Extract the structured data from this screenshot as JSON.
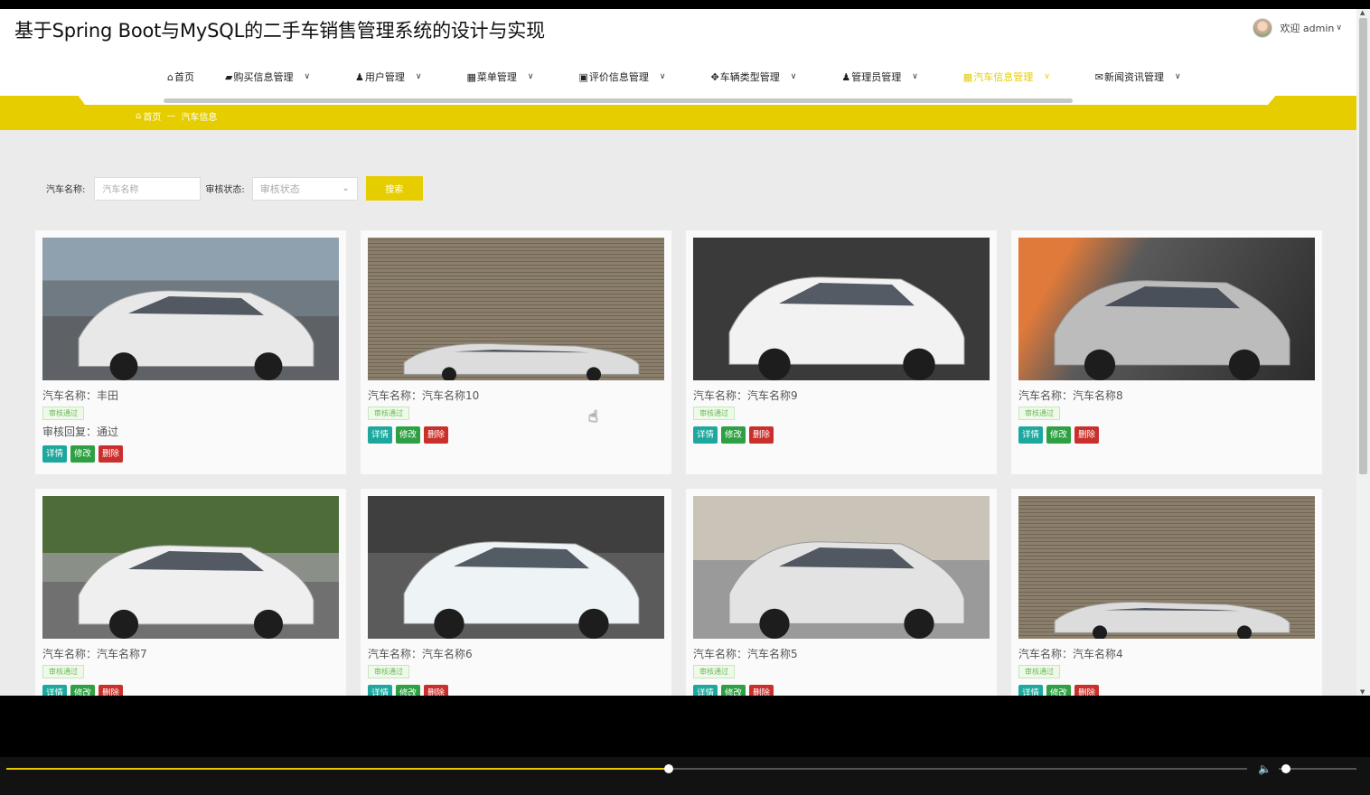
{
  "header": {
    "title": "基于Spring Boot与MySQL的二手车销售管理系统的设计与实现",
    "welcome": "欢迎 admin",
    "user_chevron": "∨"
  },
  "nav": {
    "items": [
      {
        "icon": "⌂",
        "label": "首页",
        "chev": ""
      },
      {
        "icon": "▰",
        "label": "购买信息管理",
        "chev": "∨"
      },
      {
        "icon": "♟",
        "label": "用户管理",
        "chev": "∨"
      },
      {
        "icon": "▦",
        "label": "菜单管理",
        "chev": "∨"
      },
      {
        "icon": "▣",
        "label": "评价信息管理",
        "chev": "∨"
      },
      {
        "icon": "✥",
        "label": "车辆类型管理",
        "chev": "∨"
      },
      {
        "icon": "♟",
        "label": "管理员管理",
        "chev": "∨"
      },
      {
        "icon": "▦",
        "label": "汽车信息管理",
        "chev": "∨"
      },
      {
        "icon": "✉",
        "label": "新闻资讯管理",
        "chev": "∨"
      }
    ],
    "active_index": 7,
    "accent_color": "#e6cd00"
  },
  "breadcrumb": {
    "home_icon": "⌂",
    "home": "首页",
    "sep": "—",
    "current": "汽车信息"
  },
  "search": {
    "name_label": "汽车名称:",
    "name_placeholder": "汽车名称",
    "status_label": "审核状态:",
    "status_placeholder": "审核状态",
    "status_chevron": "⌄",
    "button": "搜索"
  },
  "cards": [
    {
      "name": "汽车名称：丰田",
      "badge": "审核通过",
      "reply": "审核回复：通过",
      "detail": "详情",
      "edit": "修改",
      "del": "删除"
    },
    {
      "name": "汽车名称：汽车名称10",
      "badge": "审核通过",
      "reply": "",
      "detail": "详情",
      "edit": "修改",
      "del": "删除"
    },
    {
      "name": "汽车名称：汽车名称9",
      "badge": "审核通过",
      "reply": "",
      "detail": "详情",
      "edit": "修改",
      "del": "删除"
    },
    {
      "name": "汽车名称：汽车名称8",
      "badge": "审核通过",
      "reply": "",
      "detail": "详情",
      "edit": "修改",
      "del": "删除"
    },
    {
      "name": "汽车名称：汽车名称7",
      "badge": "审核通过",
      "reply": "",
      "detail": "详情",
      "edit": "修改",
      "del": "删除"
    },
    {
      "name": "汽车名称：汽车名称6",
      "badge": "审核通过",
      "reply": "",
      "detail": "详情",
      "edit": "修改",
      "del": "删除"
    },
    {
      "name": "汽车名称：汽车名称5",
      "badge": "审核通过",
      "reply": "",
      "detail": "详情",
      "edit": "修改",
      "del": "删除"
    },
    {
      "name": "汽车名称：汽车名称4",
      "badge": "审核通过",
      "reply": "",
      "detail": "详情",
      "edit": "修改",
      "del": "删除"
    }
  ],
  "player": {
    "progress": 0.534,
    "volume": 0.04,
    "volume_icon": "🔈"
  }
}
